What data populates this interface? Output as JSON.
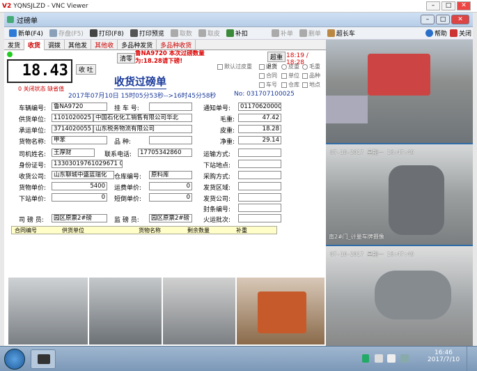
{
  "vnc": {
    "logo": "V2",
    "title": "YQNSJLZD - VNC Viewer"
  },
  "window": {
    "title": "过磅单"
  },
  "toolbar": [
    {
      "label": "新单(F4)",
      "color": "#2d7bd6",
      "enabled": true
    },
    {
      "label": "存盘(F5)",
      "color": "#8aa0b8",
      "enabled": false
    },
    {
      "label": "打印(F8)",
      "color": "#444",
      "enabled": true
    },
    {
      "label": "打印预览",
      "color": "#555",
      "enabled": true
    },
    {
      "label": "取数",
      "color": "#aaa",
      "enabled": false
    },
    {
      "label": "取皮",
      "color": "#aaa",
      "enabled": false
    },
    {
      "label": "补扣",
      "color": "#3a8a3a",
      "enabled": true
    },
    {
      "label": "补单",
      "color": "#aaa",
      "enabled": false
    },
    {
      "label": "删单",
      "color": "#aaa",
      "enabled": false
    },
    {
      "label": "超长车",
      "color": "#b84",
      "enabled": true
    }
  ],
  "toolbar_right": {
    "help": "帮助",
    "close": "关闭"
  },
  "tabs": [
    {
      "label": "发货",
      "active": false,
      "red": false
    },
    {
      "label": "收货",
      "active": true,
      "red": true
    },
    {
      "label": "调拨",
      "active": false,
      "red": false
    },
    {
      "label": "其他发",
      "active": false,
      "red": false
    },
    {
      "label": "其他收",
      "active": false,
      "red": true
    },
    {
      "label": "多品种发货",
      "active": false,
      "red": false
    },
    {
      "label": "多品种收货",
      "active": false,
      "red": true
    }
  ],
  "scale": {
    "weight": "18.43",
    "status_btn": "收 吐",
    "clear_btn": "清零",
    "notice": "鲁NA9720 本次过磅数量为:18.28请下磅!",
    "overweight_btn": "超重",
    "counter": "18:19 / 18:28",
    "status_line": "0 关闭状态  缺省值"
  },
  "options": {
    "default_tare": "默认过皮重",
    "return_goods": "退货",
    "gross": "皮重",
    "net": "毛重",
    "contract": "合同",
    "unit": "单位",
    "variety": "品种",
    "car_no": "车号",
    "warehouse": "仓库",
    "place": "地点"
  },
  "form": {
    "title": "收货过磅单",
    "date_line": "2017年07月10日 15时05分53秒-->16时45分58秒",
    "no": "No: 031707100025",
    "vehicle_label": "车辆编号:",
    "vehicle": "鲁NA9720",
    "trailer_label": "挂 车 号:",
    "trailer": "",
    "notice_label": "通知单号:",
    "notice_no": "01170620000",
    "supplier_label": "供货单位:",
    "supplier_code": "1101020025",
    "supplier_name": "中国石化化工销售有限公司华北",
    "gross_label": "毛重:",
    "gross": "47.42",
    "carrier_label": "承运单位:",
    "carrier_code": "3714020055",
    "carrier_name": "山东税务物流有限公司",
    "tare_label": "皮重:",
    "tare": "18.28",
    "goods_label": "货物名称:",
    "goods": "甲苯",
    "variety_label": "品 种:",
    "variety": "",
    "net_label": "净重:",
    "net": "29.14",
    "driver_label": "司机姓名:",
    "driver": "王厚财",
    "phone_label": "联系电话:",
    "phone": "17705342860",
    "transport_label": "运输方式:",
    "transport": "",
    "id_label": "身份证号:",
    "id": "13303019761029671 0",
    "unload_place_label": "下站地点:",
    "unload_place": "",
    "receiver_label": "收货公司:",
    "receiver": "山东聊城中盛蓝瑞化",
    "warehouse_label": "仓库编号:",
    "warehouse": "原料库",
    "purchase_label": "采购方式:",
    "purchase": "",
    "price_label": "货物单价:",
    "price": "5400",
    "freight_label": "运费单价:",
    "freight": "0",
    "ship_region_label": "发货区域:",
    "ship_region": "",
    "unload_price_label": "下站单价:",
    "unload_price": "0",
    "short_price_label": "短倒单价:",
    "short_price": "0",
    "ship_company_label": "发货公司:",
    "ship_company": "",
    "seal_label": "封条编号:",
    "seal": "",
    "weigher_label": "司 磅 员:",
    "weigher": "园区原票2#磅",
    "supervisor_label": "监 磅 员:",
    "supervisor": "园区原票2#磅",
    "batch_label": "火运批次:",
    "batch": ""
  },
  "table_headers": [
    "合同编号",
    "供货单位",
    "货物名称",
    "剩余数量",
    "补重"
  ],
  "cameras": {
    "cam2_ts": "07-10-2017 星期一 16:47:49",
    "cam2_label": "南2#门_计量车牌摄像",
    "cam3_ts": "07-10-2017 星期一 16:47:49"
  },
  "taskbar": {
    "time": "16:46",
    "date": "2017/7/10"
  }
}
